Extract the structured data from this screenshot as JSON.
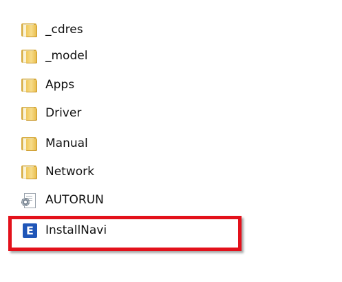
{
  "items": [
    {
      "label": "_cdres",
      "type": "folder",
      "icon": "folder-icon"
    },
    {
      "label": "_model",
      "type": "folder",
      "icon": "folder-icon"
    },
    {
      "label": "Apps",
      "type": "folder",
      "icon": "folder-icon"
    },
    {
      "label": "Driver",
      "type": "folder",
      "icon": "folder-icon"
    },
    {
      "label": "Manual",
      "type": "folder",
      "icon": "folder-icon"
    },
    {
      "label": "Network",
      "type": "folder",
      "icon": "folder-icon"
    },
    {
      "label": "AUTORUN",
      "type": "settings-file",
      "icon": "settings-file-icon"
    },
    {
      "label": "InstallNavi",
      "type": "application",
      "icon": "app-icon",
      "icon_letter": "E"
    }
  ],
  "highlight": {
    "color": "#e3111b",
    "target": "InstallNavi"
  }
}
